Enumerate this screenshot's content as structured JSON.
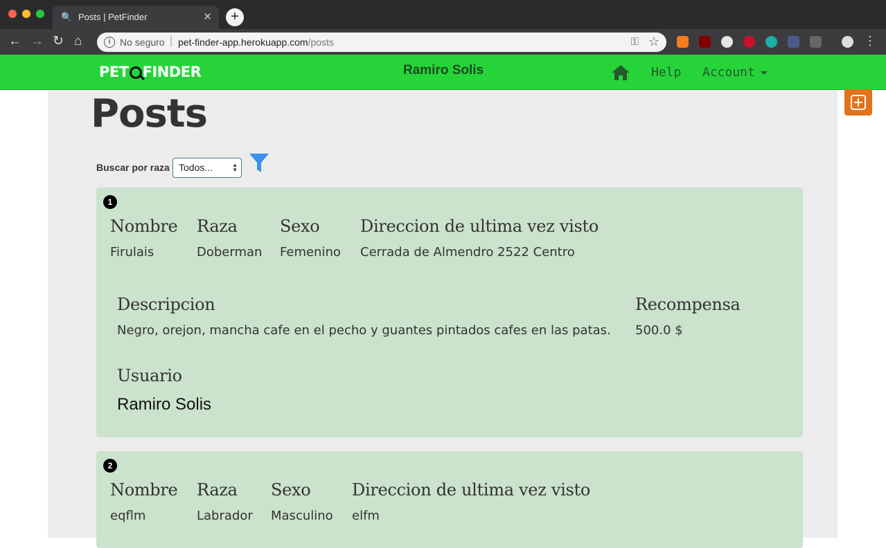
{
  "browser": {
    "tab_title": "Posts | PetFinder",
    "security_label": "No seguro",
    "url_domain": "pet-finder-app.herokuapp.com",
    "url_path": "/posts"
  },
  "navbar": {
    "logo_left": "PET",
    "logo_right": "FINDER",
    "user_name": "Ramiro Solis",
    "help_label": "Help",
    "account_label": "Account"
  },
  "page": {
    "title": "Posts"
  },
  "filter": {
    "label": "Buscar por raza",
    "selected": "Todos..."
  },
  "posts": [
    {
      "number": "1",
      "name_header": "Nombre",
      "name": "Firulais",
      "breed_header": "Raza",
      "breed": "Doberman",
      "sex_header": "Sexo",
      "sex": "Femenino",
      "address_header": "Direccion de ultima vez visto",
      "address": "Cerrada de Almendro 2522 Centro",
      "description_header": "Descripcion",
      "description": "Negro, orejon, mancha cafe en el pecho y guantes pintados cafes en las patas.",
      "reward_header": "Recompensa",
      "reward": "500.0 $",
      "user_header": "Usuario",
      "user": "Ramiro Solis"
    },
    {
      "number": "2",
      "name_header": "Nombre",
      "name": "eqflm",
      "breed_header": "Raza",
      "breed": "Labrador",
      "sex_header": "Sexo",
      "sex": "Masculino",
      "address_header": "Direccion de ultima vez visto",
      "address": "elfm"
    }
  ],
  "colors": {
    "navbar_green": "#26d43a",
    "card_green": "#cbe2cd",
    "add_button_orange": "#e2731b",
    "filter_blue": "#3a8ff0"
  }
}
